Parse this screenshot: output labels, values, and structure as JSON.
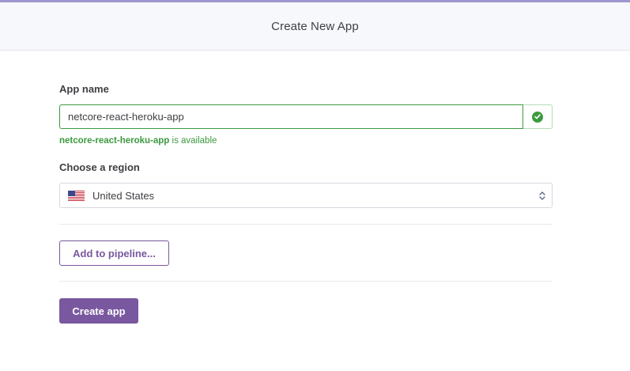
{
  "header": {
    "title": "Create New App"
  },
  "form": {
    "app_name_label": "App name",
    "app_name_value": "netcore-react-heroku-app",
    "availability_name": "netcore-react-heroku-app",
    "availability_suffix": " is available",
    "region_label": "Choose a region",
    "region_value": "United States",
    "region_flag_icon": "us-flag-icon",
    "valid_icon": "check-circle-icon"
  },
  "actions": {
    "pipeline_button": "Add to pipeline...",
    "create_button": "Create app"
  },
  "colors": {
    "accent": "#79589f",
    "success": "#3c9a3f",
    "header_bg": "#f7f8fb",
    "top_bar": "#9e96cf"
  }
}
